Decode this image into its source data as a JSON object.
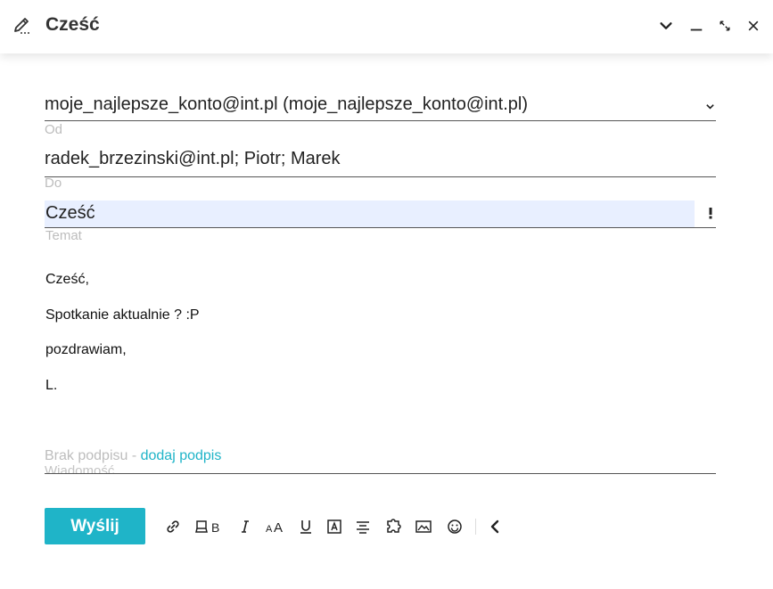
{
  "window": {
    "title": "Cześć"
  },
  "from": {
    "value": "moje_najlepsze_konto@int.pl (moje_najlepsze_konto@int.pl)",
    "label": "Od"
  },
  "to": {
    "value": "radek_brzezinski@int.pl; Piotr; Marek",
    "label": "Do"
  },
  "subject": {
    "value": "Cześć",
    "label": "Temat",
    "priority_icon": "exclamation-icon"
  },
  "body": {
    "lines": [
      "Cześć,",
      "Spotkanie aktualnie ? :P",
      "pozdrawiam,",
      "L."
    ]
  },
  "signature": {
    "text": "Brak podpisu - ",
    "link": "dodaj podpis"
  },
  "message": {
    "label": "Wiadomość"
  },
  "toolbar": {
    "send_label": "Wyślij",
    "tools": [
      "link-icon",
      "bold-icon",
      "italic-icon",
      "font-size-icon",
      "underline-icon",
      "text-color-icon",
      "align-icon",
      "template-icon",
      "image-icon",
      "emoji-icon",
      "collapse-icon"
    ]
  },
  "colors": {
    "accent": "#1fb4c8",
    "subject_bg": "#e8efff"
  }
}
